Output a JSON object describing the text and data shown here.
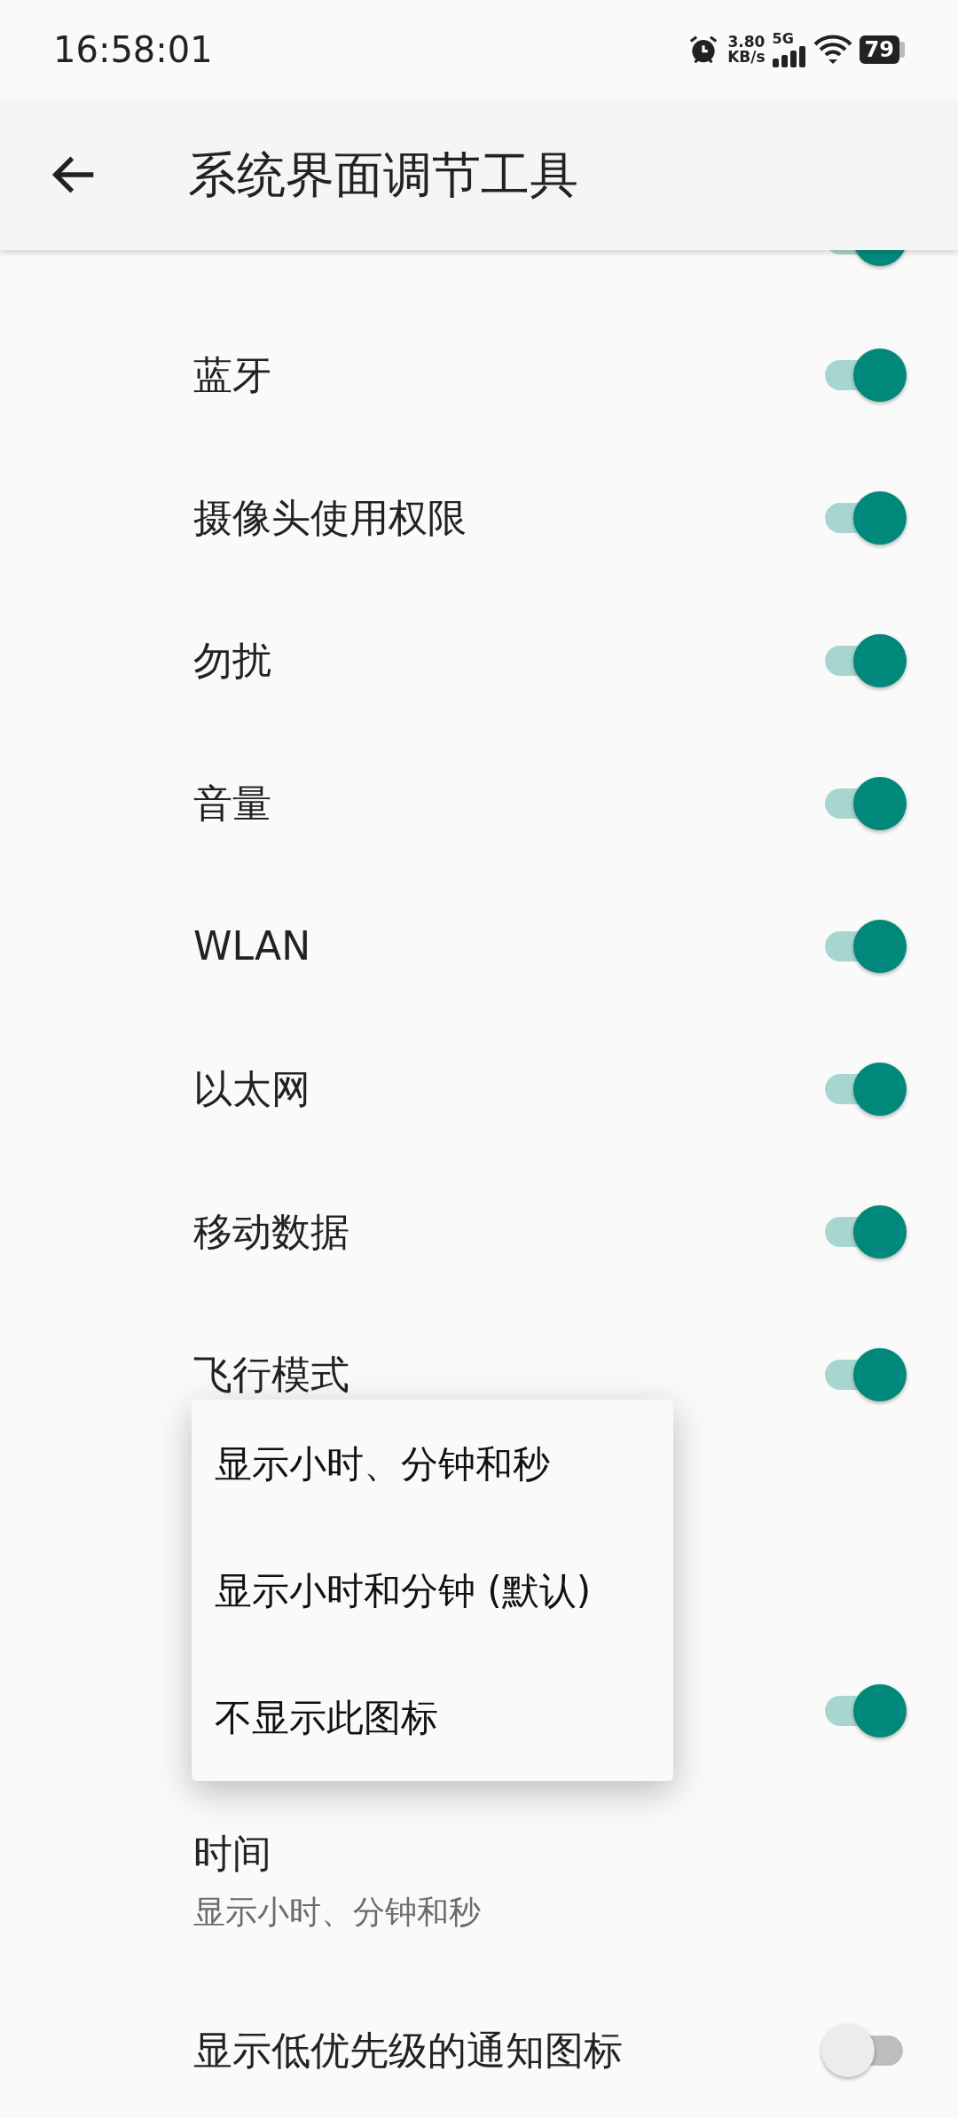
{
  "status_bar": {
    "time": "16:58:01",
    "net_speed": "3.80",
    "net_speed_unit": "KB/s",
    "network_type": "5G",
    "battery": "79"
  },
  "app_bar": {
    "title": "系统界面调节工具"
  },
  "settings": [
    {
      "kind": "partial",
      "checked": true
    },
    {
      "kind": "switch",
      "title": "蓝牙",
      "checked": true
    },
    {
      "kind": "switch",
      "title": "摄像头使用权限",
      "checked": true
    },
    {
      "kind": "switch",
      "title": "勿扰",
      "checked": true
    },
    {
      "kind": "switch",
      "title": "音量",
      "checked": true
    },
    {
      "kind": "switch",
      "title": "WLAN",
      "checked": true
    },
    {
      "kind": "switch",
      "title": "以太网",
      "checked": true
    },
    {
      "kind": "switch",
      "title": "移动数据",
      "checked": true
    },
    {
      "kind": "switch",
      "title": "飞行模式",
      "checked": true
    },
    {
      "kind": "blank"
    },
    {
      "kind": "switch",
      "checked": true
    },
    {
      "kind": "choice",
      "title": "时间",
      "summary": "显示小时、分钟和秒"
    },
    {
      "kind": "switch",
      "title": "显示低优先级的通知图标",
      "checked": false
    }
  ],
  "popup_menu": {
    "items": [
      {
        "label": "显示小时、分钟和秒"
      },
      {
        "label": "显示小时和分钟 (默认)"
      },
      {
        "label": "不显示此图标"
      }
    ]
  }
}
